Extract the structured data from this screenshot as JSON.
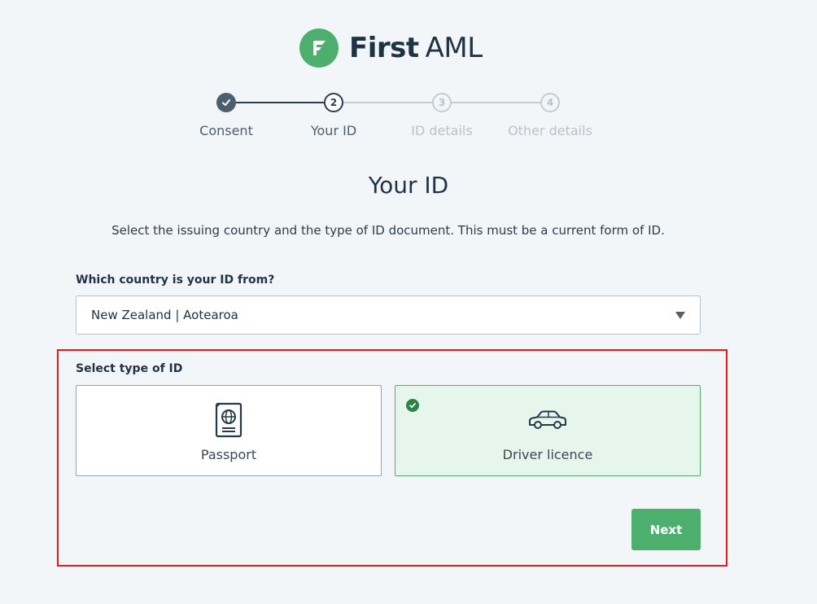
{
  "brand": {
    "first": "First",
    "aml": "AML",
    "accent": "#4caf6e",
    "icon": "first-aml-logo-icon"
  },
  "stepper": {
    "steps": [
      {
        "label": "Consent",
        "number": "1",
        "state": "complete"
      },
      {
        "label": "Your ID",
        "number": "2",
        "state": "current"
      },
      {
        "label": "ID details",
        "number": "3",
        "state": "upcoming"
      },
      {
        "label": "Other details",
        "number": "4",
        "state": "upcoming"
      }
    ],
    "colors": {
      "complete": "#4b5f70",
      "current": "#2b3f52",
      "upcoming": "#b9c2ca"
    }
  },
  "page": {
    "title": "Your ID",
    "subtitle": "Select the issuing country and the type of ID document. This must be a current form of ID."
  },
  "country": {
    "label": "Which country is your ID from?",
    "selected": "New Zealand | Aotearoa"
  },
  "id_type": {
    "label": "Select type of ID",
    "options": [
      {
        "label": "Passport",
        "icon": "passport-icon",
        "selected": false
      },
      {
        "label": "Driver licence",
        "icon": "car-icon",
        "selected": true
      }
    ]
  },
  "actions": {
    "next_label": "Next"
  }
}
